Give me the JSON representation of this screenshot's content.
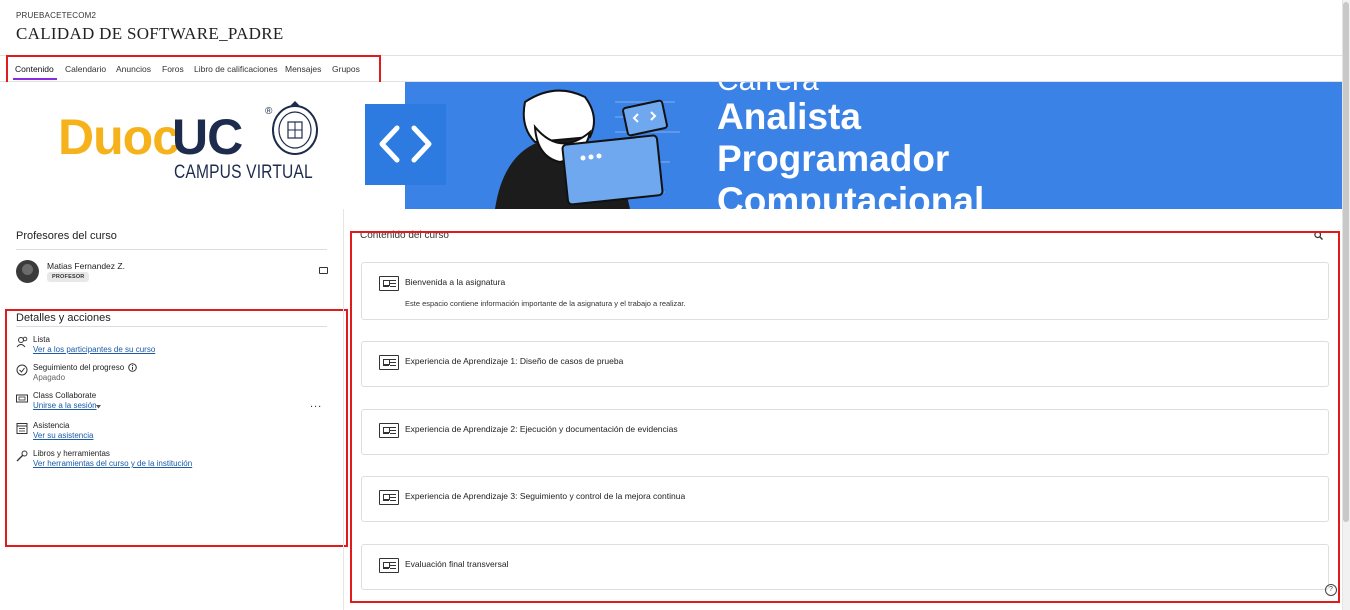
{
  "course": {
    "code": "PRUEBACETECOM2",
    "title": "CALIDAD DE SOFTWARE_PADRE"
  },
  "nav": {
    "tabs": [
      {
        "label": "Contenido",
        "active": true
      },
      {
        "label": "Calendario"
      },
      {
        "label": "Anuncios"
      },
      {
        "label": "Foros"
      },
      {
        "label": "Libro de calificaciones"
      },
      {
        "label": "Mensajes"
      },
      {
        "label": "Grupos"
      }
    ]
  },
  "banner": {
    "logo_left": "Duoc",
    "logo_right": "UC",
    "logo_reg": "®",
    "logo_sub": "CAMPUS VIRTUAL",
    "code_symbol": "< >",
    "career_line1": "Carrera",
    "career_line2": "Analista",
    "career_line3": "Programador",
    "career_line4": "Computacional",
    "colors": {
      "blue": "#3b82e6",
      "badge": "#2d7be0",
      "duoc_yellow": "#f5b21b",
      "uc_navy": "#1d2b4c"
    }
  },
  "professors": {
    "title": "Profesores del curso",
    "items": [
      {
        "name": "Matias Fernandez Z.",
        "role": "PROFESOR"
      }
    ]
  },
  "details": {
    "title": "Detalles y acciones",
    "items": [
      {
        "label": "Lista",
        "link": "Ver a los participantes de su curso",
        "icon": "roster-icon"
      },
      {
        "label": "Seguimiento del progreso",
        "sub": "Apagado",
        "icon": "progress-icon"
      },
      {
        "label": "Class Collaborate",
        "link": "Unirse a la sesión",
        "icon": "collaborate-icon"
      },
      {
        "label": "Asistencia",
        "link": "Ver su asistencia",
        "icon": "attendance-icon"
      },
      {
        "label": "Libros y herramientas",
        "link": "Ver herramientas del curso y de la institución",
        "icon": "tools-icon"
      }
    ],
    "more_label": "..."
  },
  "content": {
    "title": "Contenido del curso",
    "cards": [
      {
        "title": "Bienvenida a la asignatura",
        "desc": "Este espacio contiene información importante de la asignatura y el trabajo a realizar."
      },
      {
        "title": "Experiencia de Aprendizaje 1: Diseño de casos de prueba"
      },
      {
        "title": "Experiencia de Aprendizaje 2: Ejecución y documentación de evidencias"
      },
      {
        "title": "Experiencia de Aprendizaje 3: Seguimiento y control de la mejora continua"
      },
      {
        "title": "Evaluación final transversal"
      }
    ]
  },
  "help_label": "?",
  "accent": {
    "highlight_red": "#e01b1b",
    "tab_underline": "#8a2be2",
    "link_blue": "#1a5aa6"
  }
}
